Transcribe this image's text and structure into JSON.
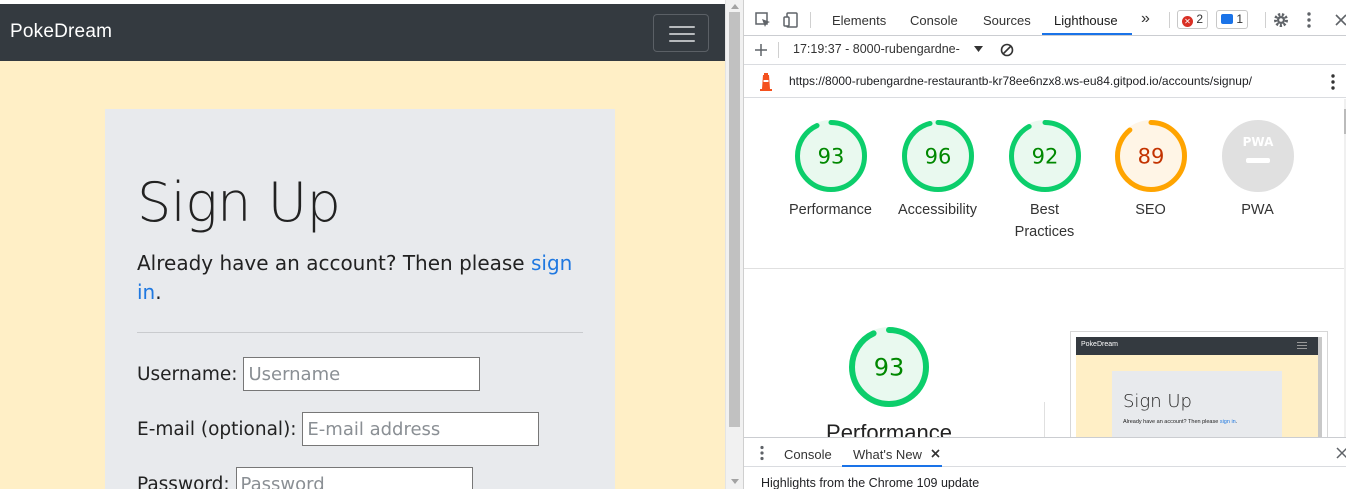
{
  "site": {
    "brand": "PokeDream",
    "title": "Sign Up",
    "lead_text": "Already have an account? Then please ",
    "lead_link": "sign in",
    "lead_end": ".",
    "fields": [
      {
        "label": "Username:",
        "placeholder": "Username"
      },
      {
        "label": "E-mail (optional):",
        "placeholder": "E-mail address"
      },
      {
        "label": "Password:",
        "placeholder": "Password"
      }
    ]
  },
  "devtools": {
    "tabs": [
      "Elements",
      "Console",
      "Sources",
      "Lighthouse"
    ],
    "active_tab": "Lighthouse",
    "more_tabs": "»",
    "error_count": "2",
    "message_count": "1",
    "report_selector": "17:19:37 - 8000-rubengardne-",
    "url": "https://8000-rubengardne-restaurantb-kr78ee6nzx8.ws-eu84.gitpod.io/accounts/signup/",
    "scores": [
      {
        "label": "Performance",
        "value": "93",
        "score": 0.93,
        "color": "#0cce6b",
        "fill": "#e9f9ef",
        "text_color": "#008800"
      },
      {
        "label": "Accessibility",
        "value": "96",
        "score": 0.96,
        "color": "#0cce6b",
        "fill": "#e9f9ef",
        "text_color": "#008800"
      },
      {
        "label": "Best Practices",
        "value": "92",
        "score": 0.92,
        "color": "#0cce6b",
        "fill": "#e9f9ef",
        "text_color": "#008800"
      },
      {
        "label": "SEO",
        "value": "89",
        "score": 0.89,
        "color": "#ffa400",
        "fill": "#fff5e6",
        "text_color": "#c33300"
      },
      {
        "label": "PWA",
        "value": "PWA",
        "score": 0,
        "color": "#e0e0e0",
        "fill": "#e0e0e0",
        "text_color": "#ffffff"
      }
    ],
    "main_score": {
      "label": "Performance",
      "value": "93",
      "score": 0.93
    },
    "thumbnail": {
      "brand": "PokeDream",
      "title": "Sign Up",
      "lead_text": "Already have an account? Then please ",
      "lead_link": "sign in",
      "lead_end": "."
    },
    "drawer": {
      "tabs": [
        "Console",
        "What's New"
      ],
      "active": "What's New",
      "content": "Highlights from the Chrome 109 update"
    }
  },
  "colors": {
    "navbar": "#343a40",
    "page_bg": "#ffefc6",
    "card_bg": "#e8eaed",
    "link": "#1f78e0",
    "devtools_accent": "#1a73e8"
  }
}
